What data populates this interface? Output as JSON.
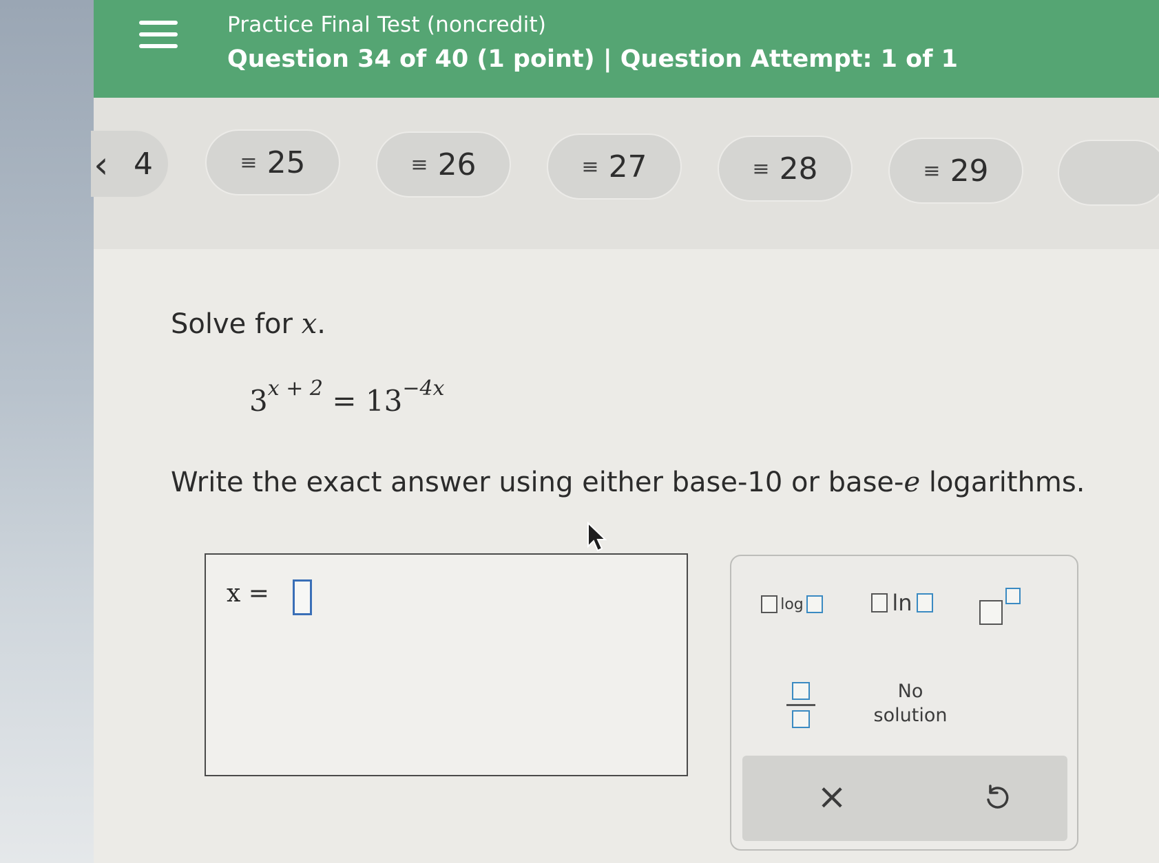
{
  "header": {
    "test_title": "Practice Final Test (noncredit)",
    "question_info": "Question 34 of 40 (1 point)  |  Question Attempt: 1 of 1"
  },
  "nav": {
    "prev_label": "4",
    "items": [
      {
        "label": "25"
      },
      {
        "label": "26"
      },
      {
        "label": "27"
      },
      {
        "label": "28"
      },
      {
        "label": "29"
      }
    ],
    "pill_icon": "list-lines-icon"
  },
  "question": {
    "prompt_text": "Solve for ",
    "prompt_var": "x",
    "prompt_end": ".",
    "equation": {
      "base_left": "3",
      "exp_left": "x + 2",
      "equals": "=",
      "base_right": "13",
      "exp_right": "−4x"
    },
    "instruction_before": "Write the exact answer using either base-10 or base-",
    "instruction_var": "e",
    "instruction_after": " logarithms."
  },
  "answer": {
    "label": "x ="
  },
  "keypad": {
    "log_label": "log",
    "ln_label": "ln",
    "no_solution_line1": "No",
    "no_solution_line2": "solution",
    "clear_label": "×"
  },
  "colors": {
    "header_green": "#55a573",
    "slot_blue": "#3a6fb7"
  }
}
